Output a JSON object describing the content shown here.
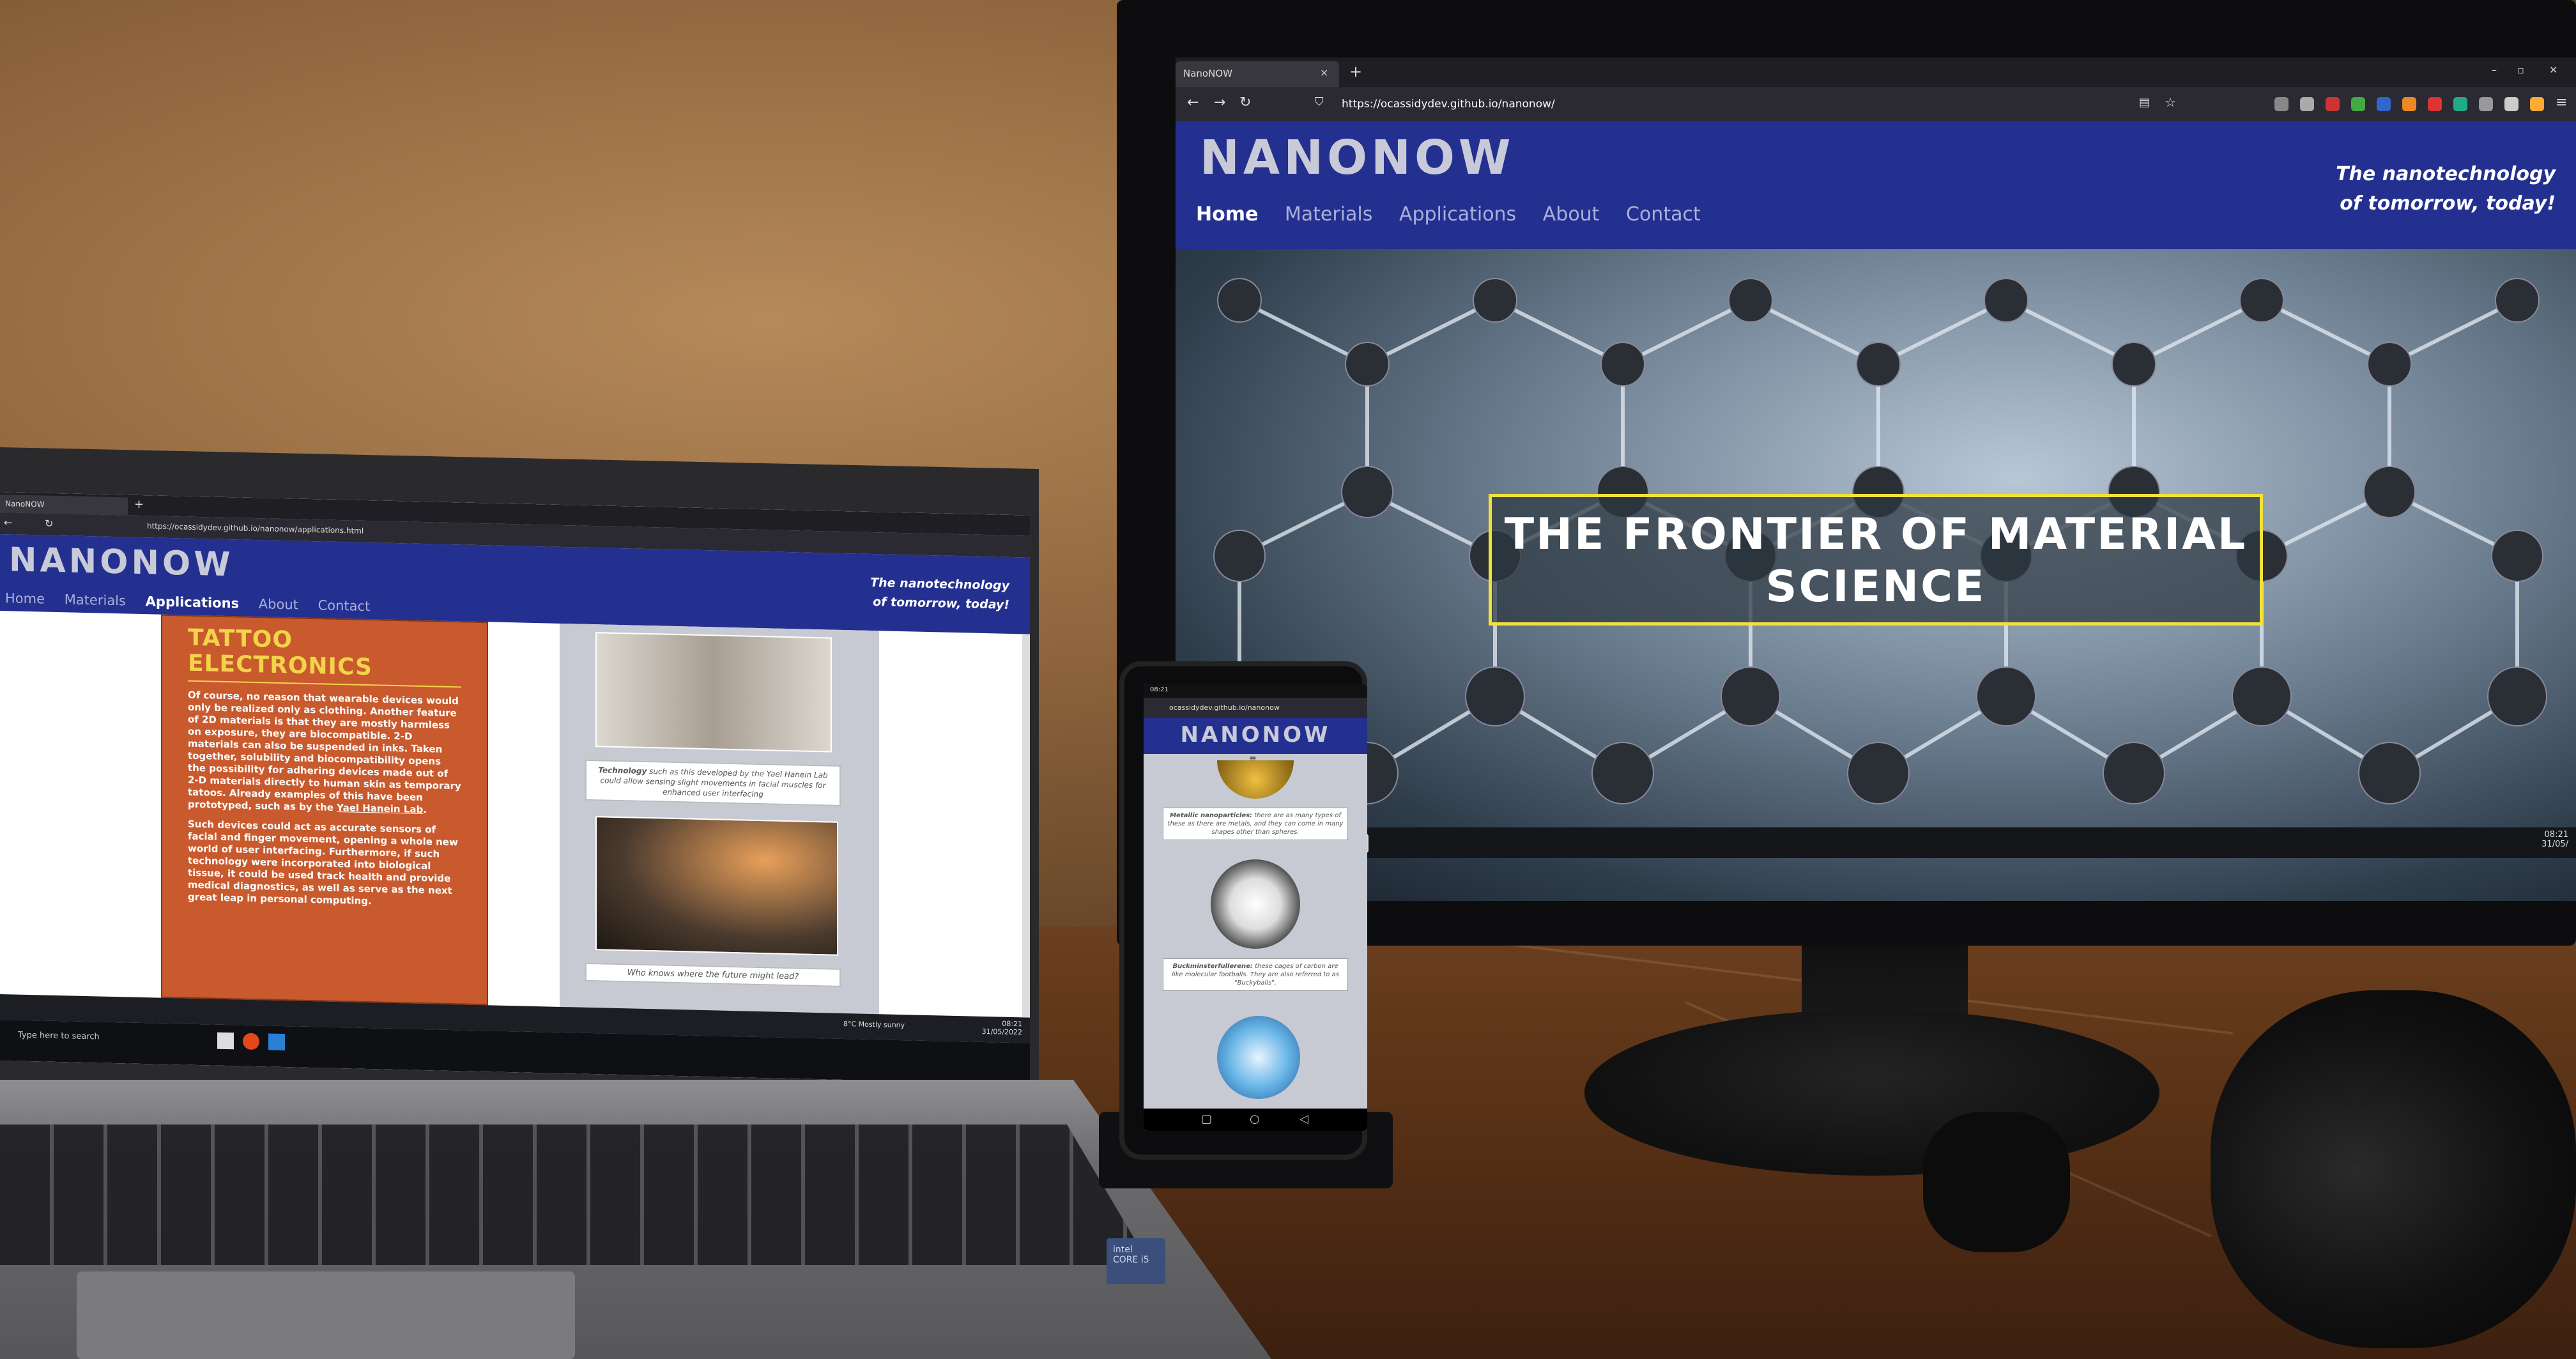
{
  "monitor": {
    "tab_title": "NanoNOW",
    "tab_close": "×",
    "new_tab": "+",
    "url": "https://ocassidydev.github.io/nanonow/",
    "logo": "NANONOW",
    "tagline_1": "The nanotechnology",
    "tagline_2": "of tomorrow, today!",
    "nav": [
      "Home",
      "Materials",
      "Applications",
      "About",
      "Contact"
    ],
    "hero_title_1": "THE FRONTIER OF MATERIAL",
    "hero_title_2": "SCIENCE",
    "clock_time": "08:21",
    "clock_date": "31/05/"
  },
  "laptop": {
    "tab_title": "NanoNOW",
    "url": "https://ocassidydev.github.io/nanonow/applications.html",
    "logo": "NANONOW",
    "tagline_1": "The nanotechnology",
    "tagline_2": "of tomorrow, today!",
    "nav": [
      "Home",
      "Materials",
      "Applications",
      "About",
      "Contact"
    ],
    "section_title_1": "TATTOO",
    "section_title_2": "ELECTRONICS",
    "para1": "Of course, no reason that wearable devices would only be realized only as clothing. Another feature of 2D materials is that they are mostly harmless on exposure, they are biocompatible. 2-D materials can also be suspended in inks. Taken together, solubility and biocompatibility opens the possibility for adhering devices made out of 2-D materials directly to human skin as temporary tatoos. Already examples of this have been prototyped, such as by the",
    "para1_link": "Yael Hanein Lab",
    "para2": "Such devices could act as accurate sensors of facial and finger movement, opening a whole new world of user interfacing. Furthermore, if such technology were incorporated into biological tissue, it could be used track health and provide medical diagnostics, as well as serve as the next great leap in personal computing.",
    "caption1_bold": "Technology",
    "caption1": "such as this developed by the Yael Hanein Lab could allow sensing slight movements in facial muscles for enhanced user interfacing",
    "caption2": "Who knows where the future might lead?",
    "search_placeholder": "Type here to search",
    "weather": "8°C  Mostly sunny",
    "clock_time": "08:21",
    "clock_date": "31/05/2022",
    "brand_sticker": "intel CORE i5"
  },
  "phone": {
    "status_time": "08:21",
    "url": "ocassidydev.github.io/nanonow",
    "logo": "NANONOW",
    "menu_icon": "≡",
    "card1_bold": "Metallic nanoparticles:",
    "card1": "there are as many types of these as there are metals, and they can come in many shapes other than spheres.",
    "card2_bold": "Buckminsterfullerene:",
    "card2": "these cages of carbon are like molecular footballs. They are also referred to as \"Buckyballs\".",
    "nav_icons": [
      "square",
      "circle",
      "triangle"
    ]
  }
}
